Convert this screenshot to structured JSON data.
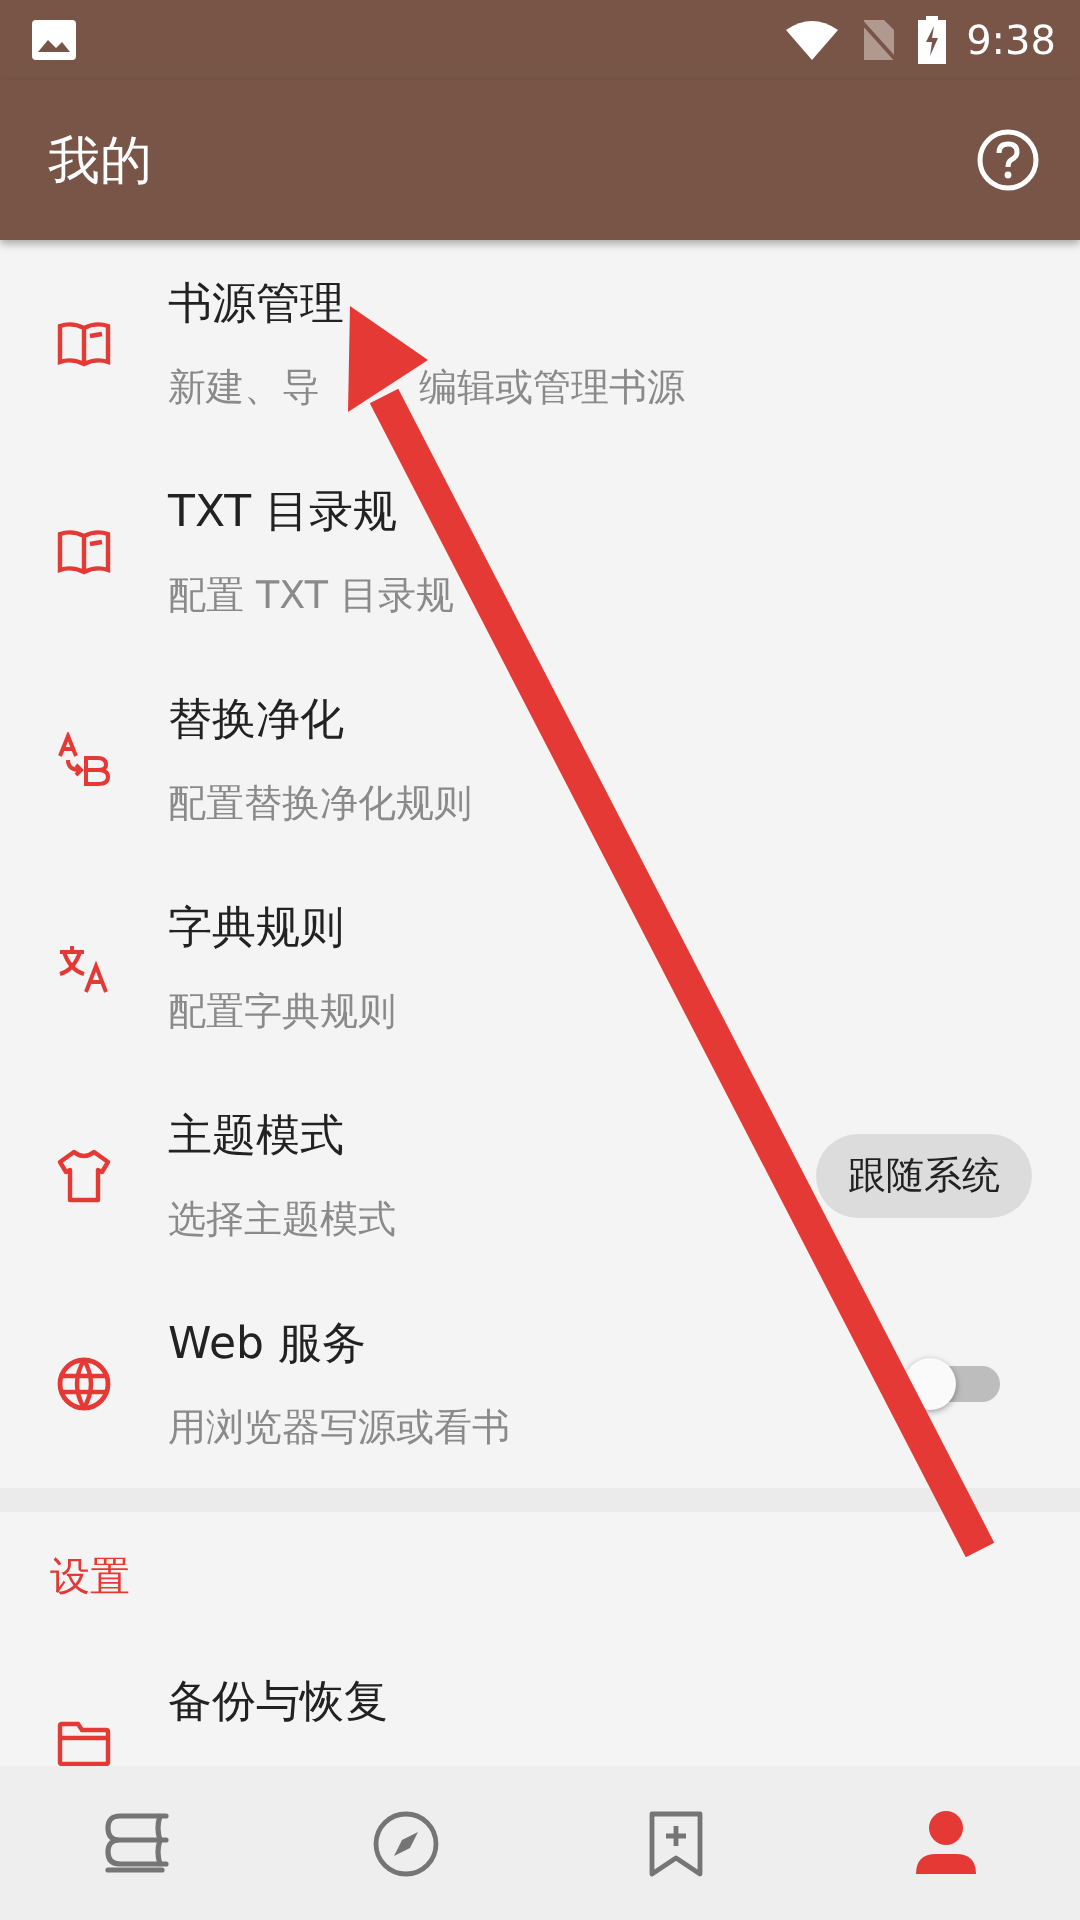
{
  "status_bar": {
    "time": "9:38"
  },
  "app_bar": {
    "title": "我的"
  },
  "items": [
    {
      "kind": "plain",
      "title": "书源管理",
      "subtitle": "新建、导",
      "subtitle_after": "编辑或管理书源"
    },
    {
      "kind": "plain",
      "title": "TXT 目录规",
      "subtitle": "配置 TXT 目录规"
    },
    {
      "kind": "plain",
      "title": "替换净化",
      "subtitle": "配置替换净化规则"
    },
    {
      "kind": "plain",
      "title": "字典规则",
      "subtitle": "配置字典规则"
    },
    {
      "kind": "option",
      "title": "主题模式",
      "subtitle": "选择主题模式",
      "value": "跟随系统"
    },
    {
      "kind": "switch",
      "title": "Web 服务",
      "subtitle": "用浏览器写源或看书",
      "on": false
    }
  ],
  "settings": {
    "header": "设置",
    "items": [
      {
        "kind": "plain",
        "title": "备份与恢复"
      }
    ]
  },
  "bottom_nav": [
    {
      "selected": false
    },
    {
      "selected": false
    },
    {
      "selected": false
    },
    {
      "selected": true
    }
  ]
}
